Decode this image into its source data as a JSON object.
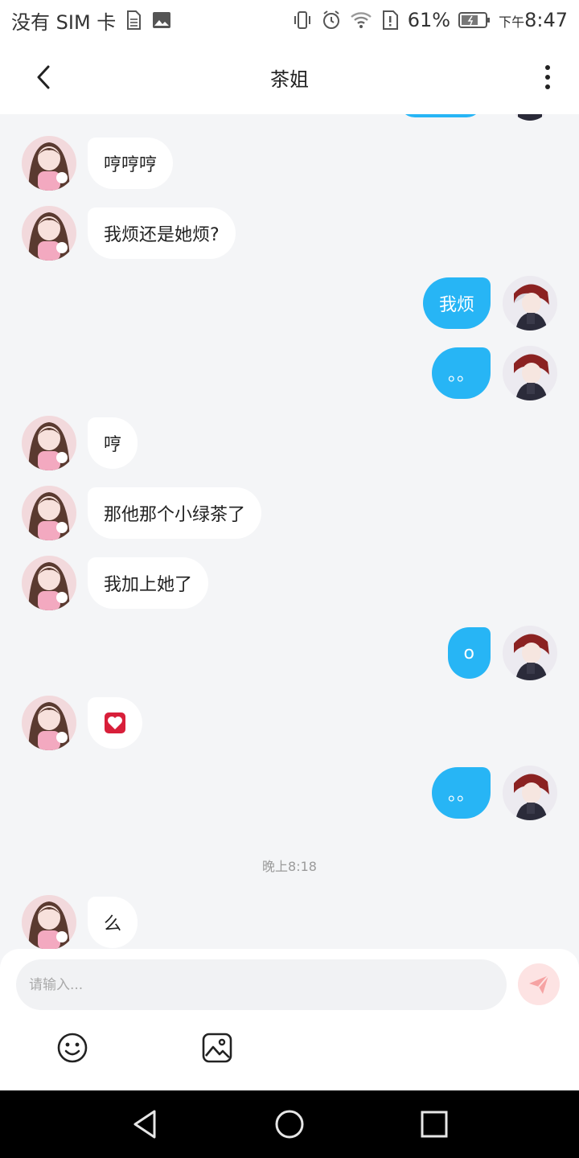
{
  "status_bar": {
    "carrier": "没有 SIM 卡",
    "battery": "61%",
    "time_prefix": "下午",
    "time": "8:47",
    "icons": [
      "sim-card-icon",
      "image-icon",
      "vibrate-icon",
      "alarm-icon",
      "wifi-icon",
      "alert-icon",
      "battery-icon"
    ]
  },
  "header": {
    "title": "茶姐",
    "back_icon": "chevron-left-icon",
    "more_icon": "more-vertical-icon"
  },
  "messages": [
    {
      "side": "in",
      "text": "哼哼哼"
    },
    {
      "side": "in",
      "text": "我烦还是她烦?"
    },
    {
      "side": "out",
      "text": "我烦"
    },
    {
      "side": "out",
      "text": "。。"
    },
    {
      "side": "in",
      "text": "哼"
    },
    {
      "side": "in",
      "text": "那他那个小绿茶了"
    },
    {
      "side": "in",
      "text": "我加上她了"
    },
    {
      "side": "out",
      "text": "o"
    },
    {
      "side": "in",
      "text": "",
      "emoji": "heart-emoji"
    },
    {
      "side": "out",
      "text": "。。"
    },
    {
      "type": "timestamp",
      "text": "晚上8:18"
    },
    {
      "side": "in",
      "text": "么"
    }
  ],
  "composer": {
    "placeholder": "请输入...",
    "value": "",
    "send_icon": "send-icon",
    "tools": [
      "emoji-icon",
      "image-icon"
    ]
  },
  "colors": {
    "accent": "#27b5f5",
    "background": "#f4f5f7",
    "incoming_bubble": "#ffffff",
    "send_button": "#fde3e3",
    "send_icon": "#f6a3a3"
  },
  "nav_bar": {
    "icons": [
      "back-triangle-icon",
      "home-circle-icon",
      "recents-square-icon"
    ]
  }
}
